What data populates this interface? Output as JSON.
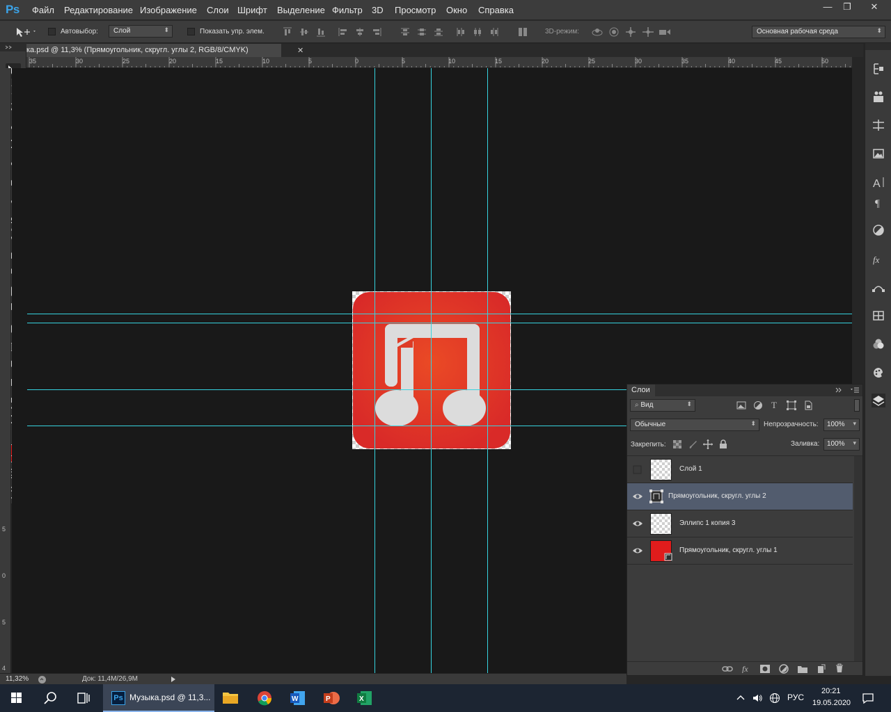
{
  "app": {
    "logo": "Ps"
  },
  "menu": [
    "Файл",
    "Редактирование",
    "Изображение",
    "Слои",
    "Шрифт",
    "Выделение",
    "Фильтр",
    "3D",
    "Просмотр",
    "Окно",
    "Справка"
  ],
  "window_buttons": {
    "minimize": "—",
    "restore": "❐",
    "close": "✕"
  },
  "options": {
    "autoselect_label": "Автовыбор:",
    "autoselect_value": "Слой",
    "show_transform_label": "Показать упр. элем.",
    "mode3d_label": "3D-режим:",
    "workspace": "Основная рабочая среда"
  },
  "document": {
    "tab_title": "ка.psd @ 11,3% (Прямоугольник, скругл. углы 2, RGB/8/CMYK)",
    "tab_close": "✕"
  },
  "ruler": {
    "h_labels": [
      "35",
      "30",
      "25",
      "20",
      "15",
      "10",
      "5",
      "0",
      "5",
      "10",
      "15",
      "20",
      "25",
      "30",
      "35",
      "40",
      "45",
      "50"
    ],
    "v_labels": [
      "5",
      "0",
      "5",
      "4"
    ]
  },
  "status": {
    "zoom": "11,32%",
    "doc": "Док: 11,4М/26,9М"
  },
  "layers_panel": {
    "title": "Слои",
    "filter": "Вид",
    "blend_mode": "Обычные",
    "opacity_label": "Непрозрачность:",
    "opacity_value": "100%",
    "lock_label": "Закрепить:",
    "fill_label": "Заливка:",
    "fill_value": "100%",
    "layers": [
      {
        "name": "Слой 1",
        "visible": false,
        "selected": false,
        "thumb": "transparent"
      },
      {
        "name": "Прямоугольник, скругл. углы 2",
        "visible": true,
        "selected": true,
        "thumb": "shape"
      },
      {
        "name": "Эллипс 1 копия 3",
        "visible": true,
        "selected": false,
        "thumb": "transparent"
      },
      {
        "name": "Прямоугольник, скругл. углы 1",
        "visible": true,
        "selected": false,
        "thumb": "red"
      }
    ]
  },
  "colors": {
    "accent": "#3ba3e8",
    "foreground": "#e81a1a",
    "background": "#e81a1a",
    "guides": "#36d4e0",
    "icon_red": "#dd2a25",
    "note_gray": "#dcdcdc"
  },
  "taskbar": {
    "active_app": "Музыка.psd @ 11,3...",
    "language": "РУС",
    "time": "20:21",
    "date": "19.05.2020"
  }
}
